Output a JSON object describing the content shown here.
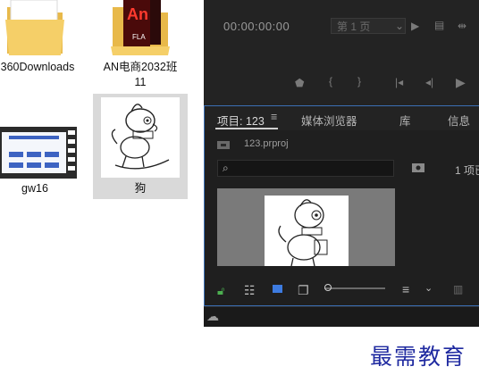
{
  "desktop": {
    "items": [
      {
        "label": "360Downloads"
      },
      {
        "label": "AN电商2032班",
        "label2": "11",
        "badge": "An",
        "badge_sub": "FLA"
      },
      {
        "label": "gw16"
      },
      {
        "label": "狗"
      }
    ]
  },
  "premiere": {
    "timecode": "00:00:00:00",
    "page_select": "第 1 页",
    "panel": {
      "tabs": [
        {
          "label": "项目: 123"
        },
        {
          "label": "媒体浏览器"
        },
        {
          "label": "库"
        },
        {
          "label": "信息"
        }
      ],
      "project_file": "123.prproj",
      "item_count": "1 项已",
      "search_placeholder": ""
    }
  },
  "watermark": "最需教育",
  "colors": {
    "panel_bg": "#232323",
    "focus_border": "#3b6fb5",
    "lock_green": "#4caf50",
    "selected_item": "#d9d9d9"
  }
}
